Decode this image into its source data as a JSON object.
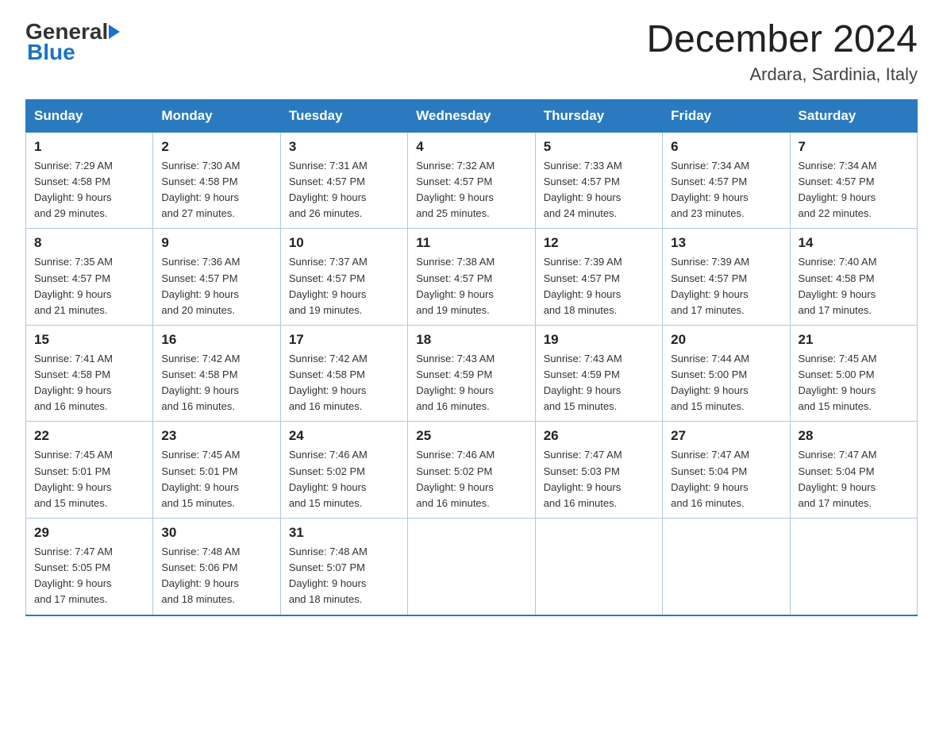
{
  "header": {
    "title": "December 2024",
    "subtitle": "Ardara, Sardinia, Italy",
    "logo_line1": "General",
    "logo_line2": "Blue"
  },
  "days_of_week": [
    "Sunday",
    "Monday",
    "Tuesday",
    "Wednesday",
    "Thursday",
    "Friday",
    "Saturday"
  ],
  "weeks": [
    [
      {
        "day": "1",
        "sunrise": "7:29 AM",
        "sunset": "4:58 PM",
        "daylight": "9 hours and 29 minutes."
      },
      {
        "day": "2",
        "sunrise": "7:30 AM",
        "sunset": "4:58 PM",
        "daylight": "9 hours and 27 minutes."
      },
      {
        "day": "3",
        "sunrise": "7:31 AM",
        "sunset": "4:57 PM",
        "daylight": "9 hours and 26 minutes."
      },
      {
        "day": "4",
        "sunrise": "7:32 AM",
        "sunset": "4:57 PM",
        "daylight": "9 hours and 25 minutes."
      },
      {
        "day": "5",
        "sunrise": "7:33 AM",
        "sunset": "4:57 PM",
        "daylight": "9 hours and 24 minutes."
      },
      {
        "day": "6",
        "sunrise": "7:34 AM",
        "sunset": "4:57 PM",
        "daylight": "9 hours and 23 minutes."
      },
      {
        "day": "7",
        "sunrise": "7:34 AM",
        "sunset": "4:57 PM",
        "daylight": "9 hours and 22 minutes."
      }
    ],
    [
      {
        "day": "8",
        "sunrise": "7:35 AM",
        "sunset": "4:57 PM",
        "daylight": "9 hours and 21 minutes."
      },
      {
        "day": "9",
        "sunrise": "7:36 AM",
        "sunset": "4:57 PM",
        "daylight": "9 hours and 20 minutes."
      },
      {
        "day": "10",
        "sunrise": "7:37 AM",
        "sunset": "4:57 PM",
        "daylight": "9 hours and 19 minutes."
      },
      {
        "day": "11",
        "sunrise": "7:38 AM",
        "sunset": "4:57 PM",
        "daylight": "9 hours and 19 minutes."
      },
      {
        "day": "12",
        "sunrise": "7:39 AM",
        "sunset": "4:57 PM",
        "daylight": "9 hours and 18 minutes."
      },
      {
        "day": "13",
        "sunrise": "7:39 AM",
        "sunset": "4:57 PM",
        "daylight": "9 hours and 17 minutes."
      },
      {
        "day": "14",
        "sunrise": "7:40 AM",
        "sunset": "4:58 PM",
        "daylight": "9 hours and 17 minutes."
      }
    ],
    [
      {
        "day": "15",
        "sunrise": "7:41 AM",
        "sunset": "4:58 PM",
        "daylight": "9 hours and 16 minutes."
      },
      {
        "day": "16",
        "sunrise": "7:42 AM",
        "sunset": "4:58 PM",
        "daylight": "9 hours and 16 minutes."
      },
      {
        "day": "17",
        "sunrise": "7:42 AM",
        "sunset": "4:58 PM",
        "daylight": "9 hours and 16 minutes."
      },
      {
        "day": "18",
        "sunrise": "7:43 AM",
        "sunset": "4:59 PM",
        "daylight": "9 hours and 16 minutes."
      },
      {
        "day": "19",
        "sunrise": "7:43 AM",
        "sunset": "4:59 PM",
        "daylight": "9 hours and 15 minutes."
      },
      {
        "day": "20",
        "sunrise": "7:44 AM",
        "sunset": "5:00 PM",
        "daylight": "9 hours and 15 minutes."
      },
      {
        "day": "21",
        "sunrise": "7:45 AM",
        "sunset": "5:00 PM",
        "daylight": "9 hours and 15 minutes."
      }
    ],
    [
      {
        "day": "22",
        "sunrise": "7:45 AM",
        "sunset": "5:01 PM",
        "daylight": "9 hours and 15 minutes."
      },
      {
        "day": "23",
        "sunrise": "7:45 AM",
        "sunset": "5:01 PM",
        "daylight": "9 hours and 15 minutes."
      },
      {
        "day": "24",
        "sunrise": "7:46 AM",
        "sunset": "5:02 PM",
        "daylight": "9 hours and 15 minutes."
      },
      {
        "day": "25",
        "sunrise": "7:46 AM",
        "sunset": "5:02 PM",
        "daylight": "9 hours and 16 minutes."
      },
      {
        "day": "26",
        "sunrise": "7:47 AM",
        "sunset": "5:03 PM",
        "daylight": "9 hours and 16 minutes."
      },
      {
        "day": "27",
        "sunrise": "7:47 AM",
        "sunset": "5:04 PM",
        "daylight": "9 hours and 16 minutes."
      },
      {
        "day": "28",
        "sunrise": "7:47 AM",
        "sunset": "5:04 PM",
        "daylight": "9 hours and 17 minutes."
      }
    ],
    [
      {
        "day": "29",
        "sunrise": "7:47 AM",
        "sunset": "5:05 PM",
        "daylight": "9 hours and 17 minutes."
      },
      {
        "day": "30",
        "sunrise": "7:48 AM",
        "sunset": "5:06 PM",
        "daylight": "9 hours and 18 minutes."
      },
      {
        "day": "31",
        "sunrise": "7:48 AM",
        "sunset": "5:07 PM",
        "daylight": "9 hours and 18 minutes."
      },
      null,
      null,
      null,
      null
    ]
  ],
  "labels": {
    "sunrise": "Sunrise:",
    "sunset": "Sunset:",
    "daylight": "Daylight:"
  }
}
